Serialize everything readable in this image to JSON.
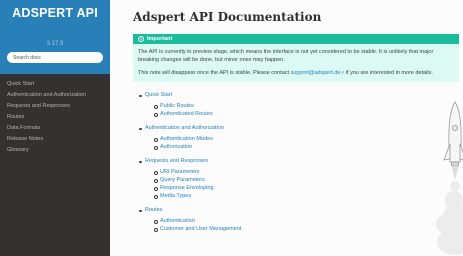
{
  "sidebar": {
    "title": "ADSPERT API",
    "version": "3.17.9",
    "search_placeholder": "Search docs",
    "items": [
      {
        "label": "Quick Start"
      },
      {
        "label": "Authentication and Authorization"
      },
      {
        "label": "Requests and Responses"
      },
      {
        "label": "Routes"
      },
      {
        "label": "Data Formats"
      },
      {
        "label": "Release Notes"
      },
      {
        "label": "Glossary"
      }
    ]
  },
  "main": {
    "title": "Adspert API Documentation",
    "admonition": {
      "title": "Important",
      "p1": "The API is currently in preview stage, which means the interface is not yet considered to be stable. It is unlikely that major breaking changes will be done, but minor ones may happen.",
      "p2_before": "This note will disappear once the API is stable. Please contact ",
      "p2_link": "support@adspert.de",
      "p2_after": " if you are interested in more details."
    },
    "toc": [
      {
        "label": "Quick Start",
        "children": [
          "Public Routes",
          "Authenticated Routes"
        ]
      },
      {
        "label": "Authentication and Authorization",
        "children": [
          "Authentication Modes",
          "Authorization"
        ]
      },
      {
        "label": "Requests and Responses",
        "children": [
          "URI Parameters",
          "Query Parameters",
          "Response Enveloping",
          "Media Types"
        ]
      },
      {
        "label": "Routes",
        "children": [
          "Authentication",
          "Customer and User Management"
        ]
      }
    ]
  },
  "colors": {
    "sidebar_bg": "#343131",
    "sidebar_header": "#2980b9",
    "admonition_head": "#1abc9c",
    "admonition_body": "#dbfaf4",
    "link": "#2980b9"
  }
}
